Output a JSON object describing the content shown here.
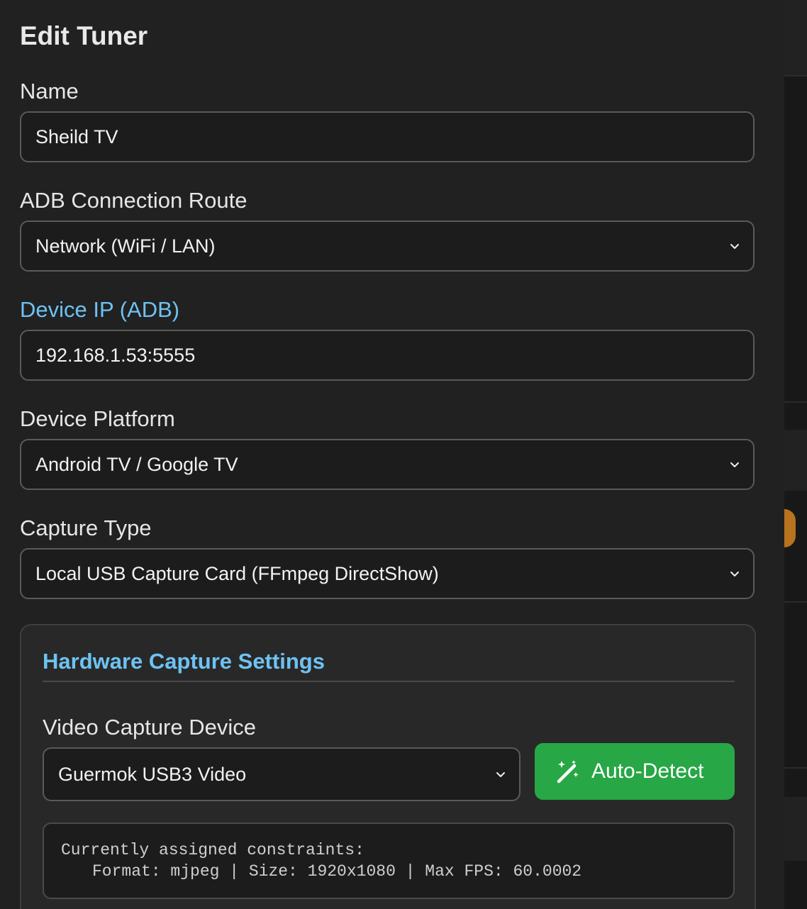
{
  "modal": {
    "title": "Edit Tuner"
  },
  "fields": {
    "name": {
      "label": "Name",
      "value": "Sheild TV"
    },
    "adb_route": {
      "label": "ADB Connection Route",
      "value": "Network (WiFi / LAN)"
    },
    "device_ip": {
      "label": "Device IP (ADB)",
      "value": "192.168.1.53:5555"
    },
    "platform": {
      "label": "Device Platform",
      "value": "Android TV / Google TV"
    },
    "capture_type": {
      "label": "Capture Type",
      "value": "Local USB Capture Card (FFmpeg DirectShow)"
    }
  },
  "hardware": {
    "title": "Hardware Capture Settings",
    "device_label": "Video Capture Device",
    "device_value": "Guermok USB3 Video",
    "auto_detect_label": "Auto-Detect",
    "constraints_heading": "Currently assigned constraints:",
    "constraints_detail": "Format: mjpeg | Size: 1920x1080 | Max FPS: 60.0002"
  },
  "colors": {
    "accent_blue": "#6ec2f2",
    "success_green": "#27a745",
    "warning_orange": "#b8731e"
  },
  "icons": {
    "select_chevron": "chevron-down-icon",
    "auto_detect": "magic-wand-icon"
  }
}
